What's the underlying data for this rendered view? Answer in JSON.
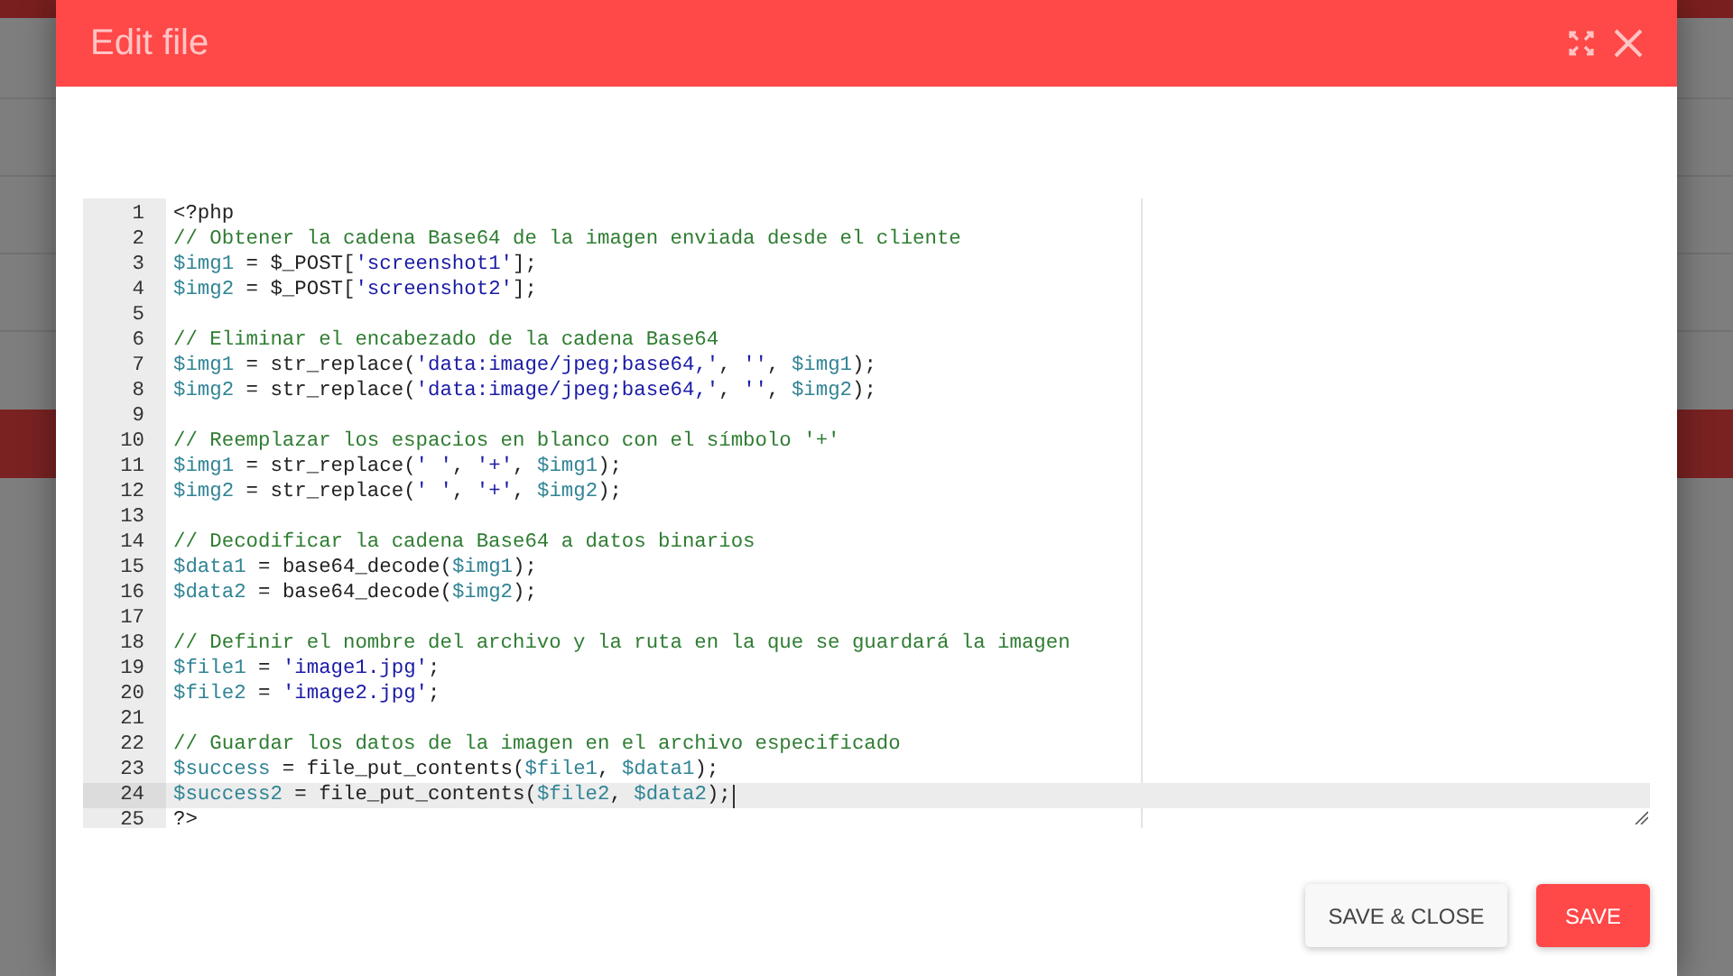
{
  "dialog": {
    "title": "Edit file"
  },
  "editor": {
    "lines": [
      {
        "number": "1",
        "active": false,
        "segments": [
          {
            "kind": "plain",
            "text": "<?php"
          }
        ]
      },
      {
        "number": "2",
        "active": false,
        "segments": [
          {
            "kind": "comment",
            "text": "// Obtener la cadena Base64 de la imagen enviada desde el cliente"
          }
        ]
      },
      {
        "number": "3",
        "active": false,
        "segments": [
          {
            "kind": "variable",
            "text": "$img1"
          },
          {
            "kind": "plain",
            "text": " = $_POST["
          },
          {
            "kind": "string",
            "text": "'screenshot1'"
          },
          {
            "kind": "plain",
            "text": "];"
          }
        ]
      },
      {
        "number": "4",
        "active": false,
        "segments": [
          {
            "kind": "variable",
            "text": "$img2"
          },
          {
            "kind": "plain",
            "text": " = $_POST["
          },
          {
            "kind": "string",
            "text": "'screenshot2'"
          },
          {
            "kind": "plain",
            "text": "];"
          }
        ]
      },
      {
        "number": "5",
        "active": false
      },
      {
        "number": "6",
        "active": false,
        "segments": [
          {
            "kind": "comment",
            "text": "// Eliminar el encabezado de la cadena Base64"
          }
        ]
      },
      {
        "number": "7",
        "active": false,
        "segments": [
          {
            "kind": "variable",
            "text": "$img1"
          },
          {
            "kind": "plain",
            "text": " = str_replace("
          },
          {
            "kind": "string",
            "text": "'data:image/jpeg;base64,'"
          },
          {
            "kind": "plain",
            "text": ", "
          },
          {
            "kind": "string",
            "text": "''"
          },
          {
            "kind": "plain",
            "text": ", "
          },
          {
            "kind": "variable",
            "text": "$img1"
          },
          {
            "kind": "plain",
            "text": ");"
          }
        ]
      },
      {
        "number": "8",
        "active": false,
        "segments": [
          {
            "kind": "variable",
            "text": "$img2"
          },
          {
            "kind": "plain",
            "text": " = str_replace("
          },
          {
            "kind": "string",
            "text": "'data:image/jpeg;base64,'"
          },
          {
            "kind": "plain",
            "text": ", "
          },
          {
            "kind": "string",
            "text": "''"
          },
          {
            "kind": "plain",
            "text": ", "
          },
          {
            "kind": "variable",
            "text": "$img2"
          },
          {
            "kind": "plain",
            "text": ");"
          }
        ]
      },
      {
        "number": "9",
        "active": false
      },
      {
        "number": "10",
        "active": false,
        "segments": [
          {
            "kind": "comment",
            "text": "// Reemplazar los espacios en blanco con el símbolo '+'"
          }
        ]
      },
      {
        "number": "11",
        "active": false,
        "segments": [
          {
            "kind": "variable",
            "text": "$img1"
          },
          {
            "kind": "plain",
            "text": " = str_replace("
          },
          {
            "kind": "string",
            "text": "' '"
          },
          {
            "kind": "plain",
            "text": ", "
          },
          {
            "kind": "string",
            "text": "'+'"
          },
          {
            "kind": "plain",
            "text": ", "
          },
          {
            "kind": "variable",
            "text": "$img1"
          },
          {
            "kind": "plain",
            "text": ");"
          }
        ]
      },
      {
        "number": "12",
        "active": false,
        "segments": [
          {
            "kind": "variable",
            "text": "$img2"
          },
          {
            "kind": "plain",
            "text": " = str_replace("
          },
          {
            "kind": "string",
            "text": "' '"
          },
          {
            "kind": "plain",
            "text": ", "
          },
          {
            "kind": "string",
            "text": "'+'"
          },
          {
            "kind": "plain",
            "text": ", "
          },
          {
            "kind": "variable",
            "text": "$img2"
          },
          {
            "kind": "plain",
            "text": ");"
          }
        ]
      },
      {
        "number": "13",
        "active": false
      },
      {
        "number": "14",
        "active": false,
        "segments": [
          {
            "kind": "comment",
            "text": "// Decodificar la cadena Base64 a datos binarios"
          }
        ]
      },
      {
        "number": "15",
        "active": false,
        "segments": [
          {
            "kind": "variable",
            "text": "$data1"
          },
          {
            "kind": "plain",
            "text": " = base64_decode("
          },
          {
            "kind": "variable",
            "text": "$img1"
          },
          {
            "kind": "plain",
            "text": ");"
          }
        ]
      },
      {
        "number": "16",
        "active": false,
        "segments": [
          {
            "kind": "variable",
            "text": "$data2"
          },
          {
            "kind": "plain",
            "text": " = base64_decode("
          },
          {
            "kind": "variable",
            "text": "$img2"
          },
          {
            "kind": "plain",
            "text": ");"
          }
        ]
      },
      {
        "number": "17",
        "active": false
      },
      {
        "number": "18",
        "active": false,
        "segments": [
          {
            "kind": "comment",
            "text": "// Definir el nombre del archivo y la ruta en la que se guardará la imagen"
          }
        ]
      },
      {
        "number": "19",
        "active": false,
        "segments": [
          {
            "kind": "variable",
            "text": "$file1"
          },
          {
            "kind": "plain",
            "text": " = "
          },
          {
            "kind": "string",
            "text": "'image1.jpg'"
          },
          {
            "kind": "plain",
            "text": ";"
          }
        ]
      },
      {
        "number": "20",
        "active": false,
        "segments": [
          {
            "kind": "variable",
            "text": "$file2"
          },
          {
            "kind": "plain",
            "text": " = "
          },
          {
            "kind": "string",
            "text": "'image2.jpg'"
          },
          {
            "kind": "plain",
            "text": ";"
          }
        ]
      },
      {
        "number": "21",
        "active": false
      },
      {
        "number": "22",
        "active": false,
        "segments": [
          {
            "kind": "comment",
            "text": "// Guardar los datos de la imagen en el archivo especificado"
          }
        ]
      },
      {
        "number": "23",
        "active": false,
        "segments": [
          {
            "kind": "variable",
            "text": "$success"
          },
          {
            "kind": "plain",
            "text": " = file_put_contents("
          },
          {
            "kind": "variable",
            "text": "$file1"
          },
          {
            "kind": "plain",
            "text": ", "
          },
          {
            "kind": "variable",
            "text": "$data1"
          },
          {
            "kind": "plain",
            "text": ");"
          }
        ]
      },
      {
        "number": "24",
        "active": true,
        "segments": [
          {
            "kind": "variable",
            "text": "$success2"
          },
          {
            "kind": "plain",
            "text": " = file_put_contents("
          },
          {
            "kind": "variable",
            "text": "$file2"
          },
          {
            "kind": "plain",
            "text": ", "
          },
          {
            "kind": "variable",
            "text": "$data2"
          },
          {
            "kind": "plain",
            "text": ");"
          }
        ]
      },
      {
        "number": "25",
        "active": false,
        "segments": [
          {
            "kind": "plain",
            "text": "?>"
          }
        ]
      }
    ]
  },
  "buttons": [
    {
      "label": "SAVE & CLOSE",
      "kind": "secondary"
    },
    {
      "label": "SAVE",
      "kind": "primary"
    }
  ]
}
